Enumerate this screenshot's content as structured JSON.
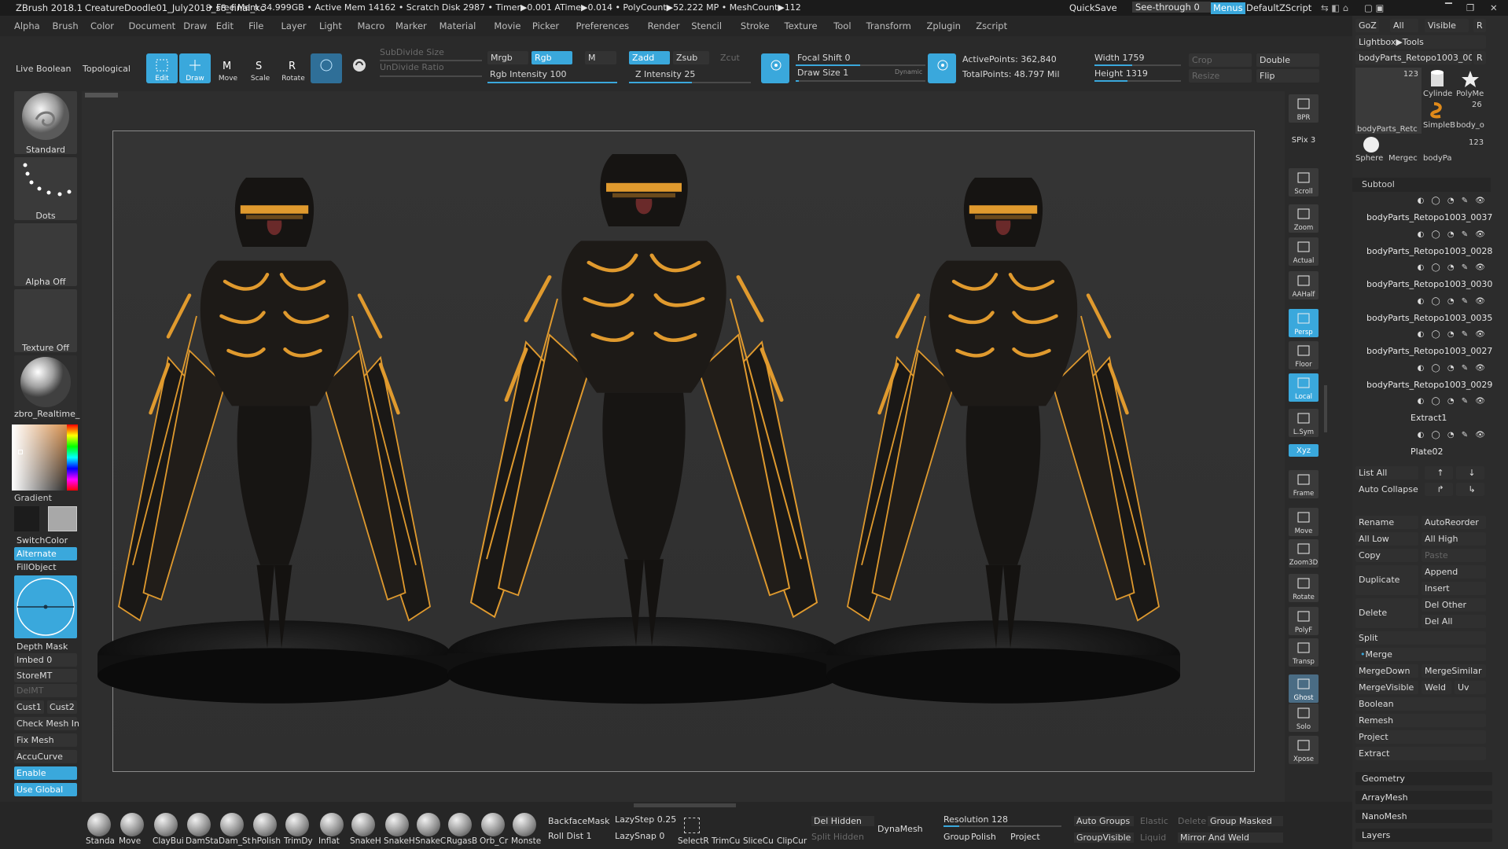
{
  "titlebar": {
    "app": "ZBrush 2018.1",
    "file": "CreatureDoodle01_July2018_s8_final_kc",
    "stats": "• Free Mem 34.999GB • Active Mem 14162 • Scratch Disk 2987 • Timer▶0.001 ATime▶0.014 • PolyCount▶52.222 MP • MeshCount▶112",
    "quicksave": "QuickSave",
    "seethrough": "See-through  0",
    "menus": "Menus",
    "script": "DefaultZScript"
  },
  "menus": [
    "Alpha",
    "Brush",
    "Color",
    "Document",
    "Draw",
    "Edit",
    "File",
    "Layer",
    "Light",
    "Macro",
    "Marker",
    "Material",
    "Movie",
    "Picker",
    "Preferences",
    "Render",
    "Stencil",
    "Stroke",
    "Texture",
    "Tool",
    "Transform",
    "Zplugin",
    "Zscript"
  ],
  "toolbar": {
    "live_boolean": "Live Boolean",
    "topological": "Topological",
    "edit": "Edit",
    "draw": "Draw",
    "move": "Move",
    "scale": "Scale",
    "rotate": "Rotate",
    "subdivide_size": "SubDivide Size",
    "undivide_ratio": "UnDivide Ratio",
    "mrgb": "Mrgb",
    "rgb": "Rgb",
    "m": "M",
    "rgb_intensity": "Rgb Intensity 100",
    "zadd": "Zadd",
    "zsub": "Zsub",
    "zcut": "Zcut",
    "z_intensity": "Z Intensity 25",
    "focal_shift": "Focal Shift 0",
    "draw_size": "Draw Size 1",
    "dynamic": "Dynamic",
    "active_points": "ActivePoints: 362,840",
    "total_points": "TotalPoints: 48.797 Mil",
    "width": "Width 1759",
    "height": "Height 1319",
    "crop": "Crop",
    "resize": "Resize",
    "double": "Double",
    "flip": "Flip"
  },
  "left": {
    "brush": "Standard",
    "stroke": "Dots",
    "alpha": "Alpha Off",
    "texture": "Texture Off",
    "material": "zbro_Realtime_",
    "gradient": "Gradient",
    "switchcolor": "SwitchColor",
    "alternate": "Alternate",
    "fillobject": "FillObject",
    "depth_mask": "Depth Mask",
    "imbed": "Imbed 0",
    "storemt": "StoreMT",
    "delmt": "DelMT",
    "cust1": "Cust1",
    "cust2": "Cust2",
    "check_mesh": "Check Mesh In",
    "fix_mesh": "Fix Mesh",
    "accucurve": "AccuCurve",
    "enable": "Enable",
    "use_global": "Use Global"
  },
  "shelf": [
    "BPR",
    "SPix 3",
    "Scroll",
    "Zoom",
    "Actual",
    "AAHalf",
    "Persp",
    "Floor",
    "Local",
    "L.Sym",
    "Xyz",
    "Frame",
    "Move",
    "Zoom3D",
    "Rotate",
    "PolyF",
    "Transp",
    "Ghost",
    "Solo",
    "Xpose"
  ],
  "tray": {
    "goz": "GoZ",
    "all": "All",
    "visible": "Visible",
    "r": "R",
    "lightbox": "Lightbox▶Tools",
    "current_tool": "bodyParts_Retopo1003_00",
    "thumbs": [
      "123",
      "Cylinde",
      "PolyMe",
      "bodyParts_Retc",
      "SimpleB",
      "body_o",
      "Sphere",
      "Mergec",
      "bodyPa",
      "26",
      "123"
    ],
    "subtool_header": "Subtool",
    "subtools": [
      "bodyParts_Retopo1003_0037",
      "bodyParts_Retopo1003_0028",
      "bodyParts_Retopo1003_0030",
      "bodyParts_Retopo1003_0035",
      "bodyParts_Retopo1003_0027",
      "bodyParts_Retopo1003_0029",
      "Extract1",
      "Plate02"
    ],
    "list_all": "List All",
    "auto_collapse": "Auto Collapse",
    "rename": "Rename",
    "autoreorder": "AutoReorder",
    "all_low": "All Low",
    "all_high": "All High",
    "copy": "Copy",
    "paste": "Paste",
    "duplicate": "Duplicate",
    "append": "Append",
    "insert": "Insert",
    "delete": "Delete",
    "del_other": "Del Other",
    "del_all": "Del All",
    "split": "Split",
    "merge": "Merge",
    "mergedown": "MergeDown",
    "mergesimilar": "MergeSimilar",
    "mergevisible": "MergeVisible",
    "weld": "Weld",
    "uv": "Uv",
    "boolean": "Boolean",
    "remesh": "Remesh",
    "project": "Project",
    "extract": "Extract",
    "geometry": "Geometry",
    "arraymesh": "ArrayMesh",
    "nanomesh": "NanoMesh",
    "layers": "Layers"
  },
  "bottom": {
    "brushes": [
      "Standa",
      "Move",
      "ClayBui",
      "DamSta",
      "Dam_St",
      "hPolish",
      "TrimDy",
      "Inflat",
      "SnakeH",
      "SnakeH",
      "SnakeC",
      "RugasB",
      "Orb_Cr",
      "Monste"
    ],
    "backfacemask": "BackfaceMask",
    "roll_dist": "Roll Dist 1",
    "lazystep": "LazyStep 0.25",
    "lazysnap": "LazySnap 0",
    "selectr": "SelectR",
    "trimcu": "TrimCu",
    "slicecu": "SliceCu",
    "clipcur": "ClipCur",
    "del_hidden": "Del Hidden",
    "split_hidden": "Split Hidden",
    "dynamesh": "DynaMesh",
    "resolution": "Resolution 128",
    "group": "Group",
    "polish": "Polish",
    "project": "Project",
    "auto_groups": "Auto Groups",
    "groupvisible": "GroupVisible",
    "elastic": "Elastic",
    "liquid": "Liquid",
    "delete": "Delete",
    "group_masked": "Group Masked",
    "mirror_weld": "Mirror And Weld"
  },
  "colors": {
    "accent": "#3aa8dc",
    "armor": "#e09a2e",
    "body": "#1c1a18"
  }
}
